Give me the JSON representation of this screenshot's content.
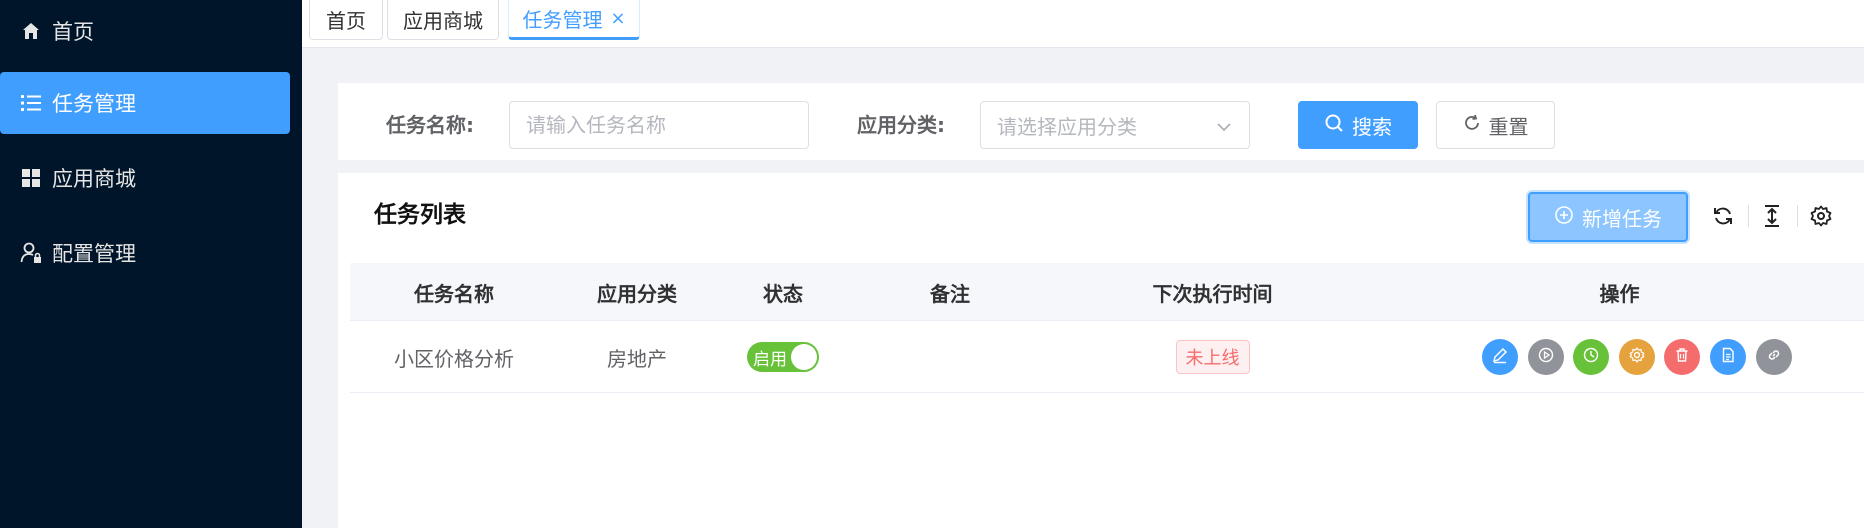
{
  "sidebar": {
    "items": [
      {
        "label": "首页",
        "icon": "home-icon"
      },
      {
        "label": "任务管理",
        "icon": "list-icon",
        "active": true
      },
      {
        "label": "应用商城",
        "icon": "grid-icon"
      },
      {
        "label": "配置管理",
        "icon": "user-lock-icon"
      }
    ]
  },
  "tabs": [
    {
      "label": "首页"
    },
    {
      "label": "应用商城"
    },
    {
      "label": "任务管理",
      "active": true,
      "close": "×"
    }
  ],
  "search": {
    "task_name_label": "任务名称:",
    "task_name_placeholder": "请输入任务名称",
    "category_label": "应用分类:",
    "category_placeholder": "请选择应用分类",
    "search_button": "搜索",
    "reset_button": "重置"
  },
  "table_panel": {
    "title": "任务列表",
    "add_button": "新增任务",
    "columns": [
      "任务名称",
      "应用分类",
      "状态",
      "备注",
      "下次执行时间",
      "操作"
    ],
    "rows": [
      {
        "name": "小区价格分析",
        "category": "房地产",
        "status_text": "启用",
        "remark": "",
        "next_run": "未上线"
      }
    ],
    "operations": [
      {
        "icon": "edit-icon",
        "color": "#409eff"
      },
      {
        "icon": "play-icon",
        "color": "#909399"
      },
      {
        "icon": "clock-icon",
        "color": "#67c23a"
      },
      {
        "icon": "gear-icon",
        "color": "#e6a23c"
      },
      {
        "icon": "trash-icon",
        "color": "#f56c6c"
      },
      {
        "icon": "document-icon",
        "color": "#409eff"
      },
      {
        "icon": "link-icon",
        "color": "#909399"
      }
    ]
  },
  "colors": {
    "primary": "#409eff",
    "sidebar_bg": "#001529",
    "success": "#67c23a",
    "danger": "#f56c6c"
  }
}
